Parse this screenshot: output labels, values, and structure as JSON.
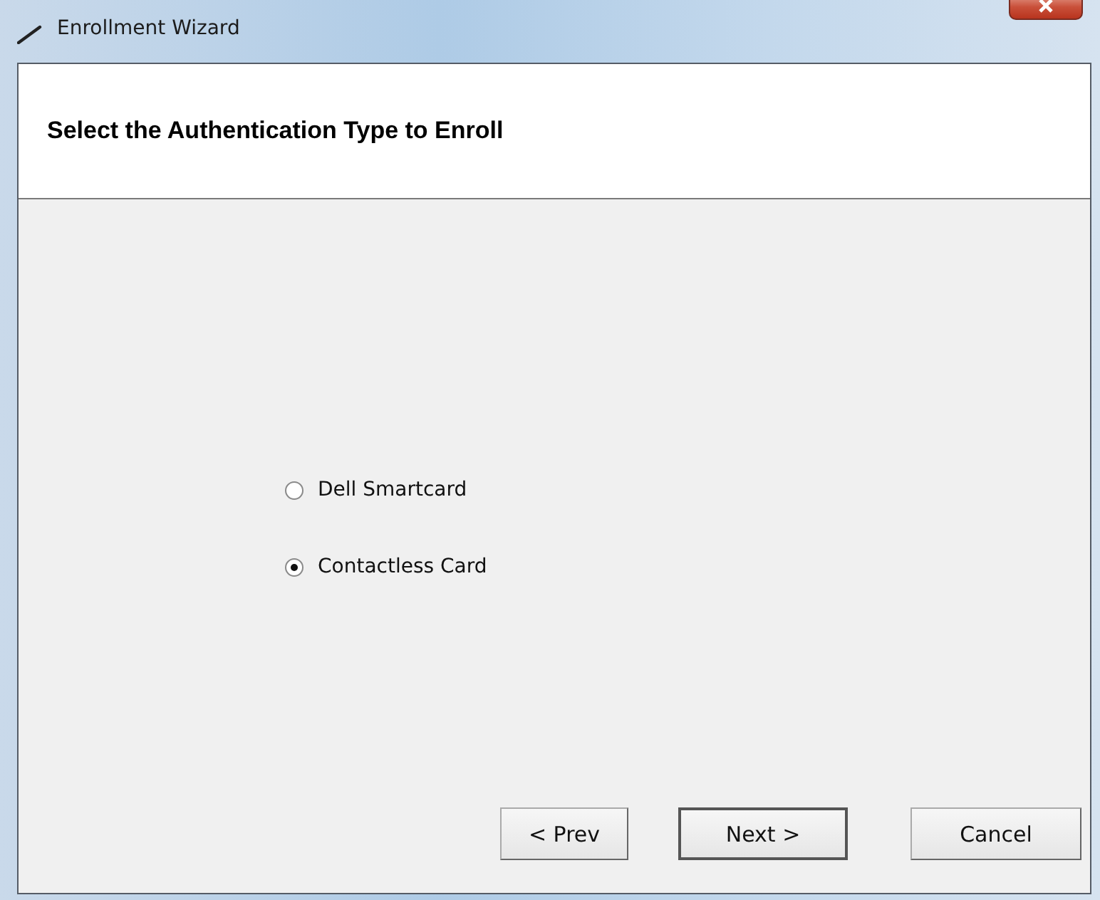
{
  "window": {
    "title": "Enrollment Wizard"
  },
  "header": {
    "title": "Select the Authentication Type to Enroll"
  },
  "options": [
    {
      "label": "Dell Smartcard",
      "selected": false
    },
    {
      "label": "Contactless Card",
      "selected": true
    }
  ],
  "buttons": [
    {
      "label": "< Prev",
      "default": false,
      "kind": "nav"
    },
    {
      "label": "Next >",
      "default": true,
      "kind": "nav"
    },
    {
      "label": "Cancel",
      "default": false,
      "kind": "cancel"
    }
  ]
}
